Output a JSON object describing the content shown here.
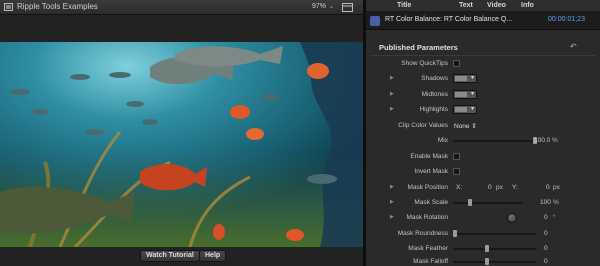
{
  "viewer": {
    "title": "Ripple Tools Examples",
    "zoom": "97%",
    "zoom_chevron": "⌄",
    "footer": {
      "tutorial_label": "Watch Tutorial",
      "help_label": "Help"
    }
  },
  "inspector": {
    "tabs": [
      "Title",
      "Text",
      "Video",
      "Info"
    ],
    "clip_name": "RT Color Balance: RT Color Balance Q...",
    "timecode": "00:00:01;23",
    "section_title": "Published Parameters",
    "reset_icon": "↶",
    "params": {
      "show_quicktips": "Show QuickTips",
      "shadows": "Shadows",
      "midtones": "Midtones",
      "highlights": "Highlights",
      "clip_color_values": "Clip Color Values",
      "clip_color_value": "None",
      "clip_color_arrows": "⇕",
      "mix": "Mix",
      "mix_value": "100.0",
      "mix_unit": "%",
      "mix_level": 1.0,
      "enable_mask": "Enable Mask",
      "invert_mask": "Invert Mask",
      "mask_position": "Mask Position",
      "mask_position_x_label": "X:",
      "mask_position_x": "0",
      "mask_position_x_unit": "px",
      "mask_position_y_label": "Y:",
      "mask_position_y": "0",
      "mask_position_y_unit": "px",
      "mask_scale": "Mask Scale",
      "mask_scale_value": "100",
      "mask_scale_unit": "%",
      "mask_rotation": "Mask Rotation",
      "mask_rotation_value": "0",
      "mask_rotation_unit": "°",
      "mask_roundness": "Mask Roundness",
      "mask_roundness_value": "0",
      "mask_feather": "Mask Feather",
      "mask_feather_value": "0",
      "mask_falloff": "Mask Falloff",
      "mask_falloff_value": "0"
    }
  },
  "colors": {
    "timecode": "#5aa3e8",
    "clip_icon": "#4a5fa8",
    "water": "#1f6f86",
    "fish": "#e0572a"
  }
}
